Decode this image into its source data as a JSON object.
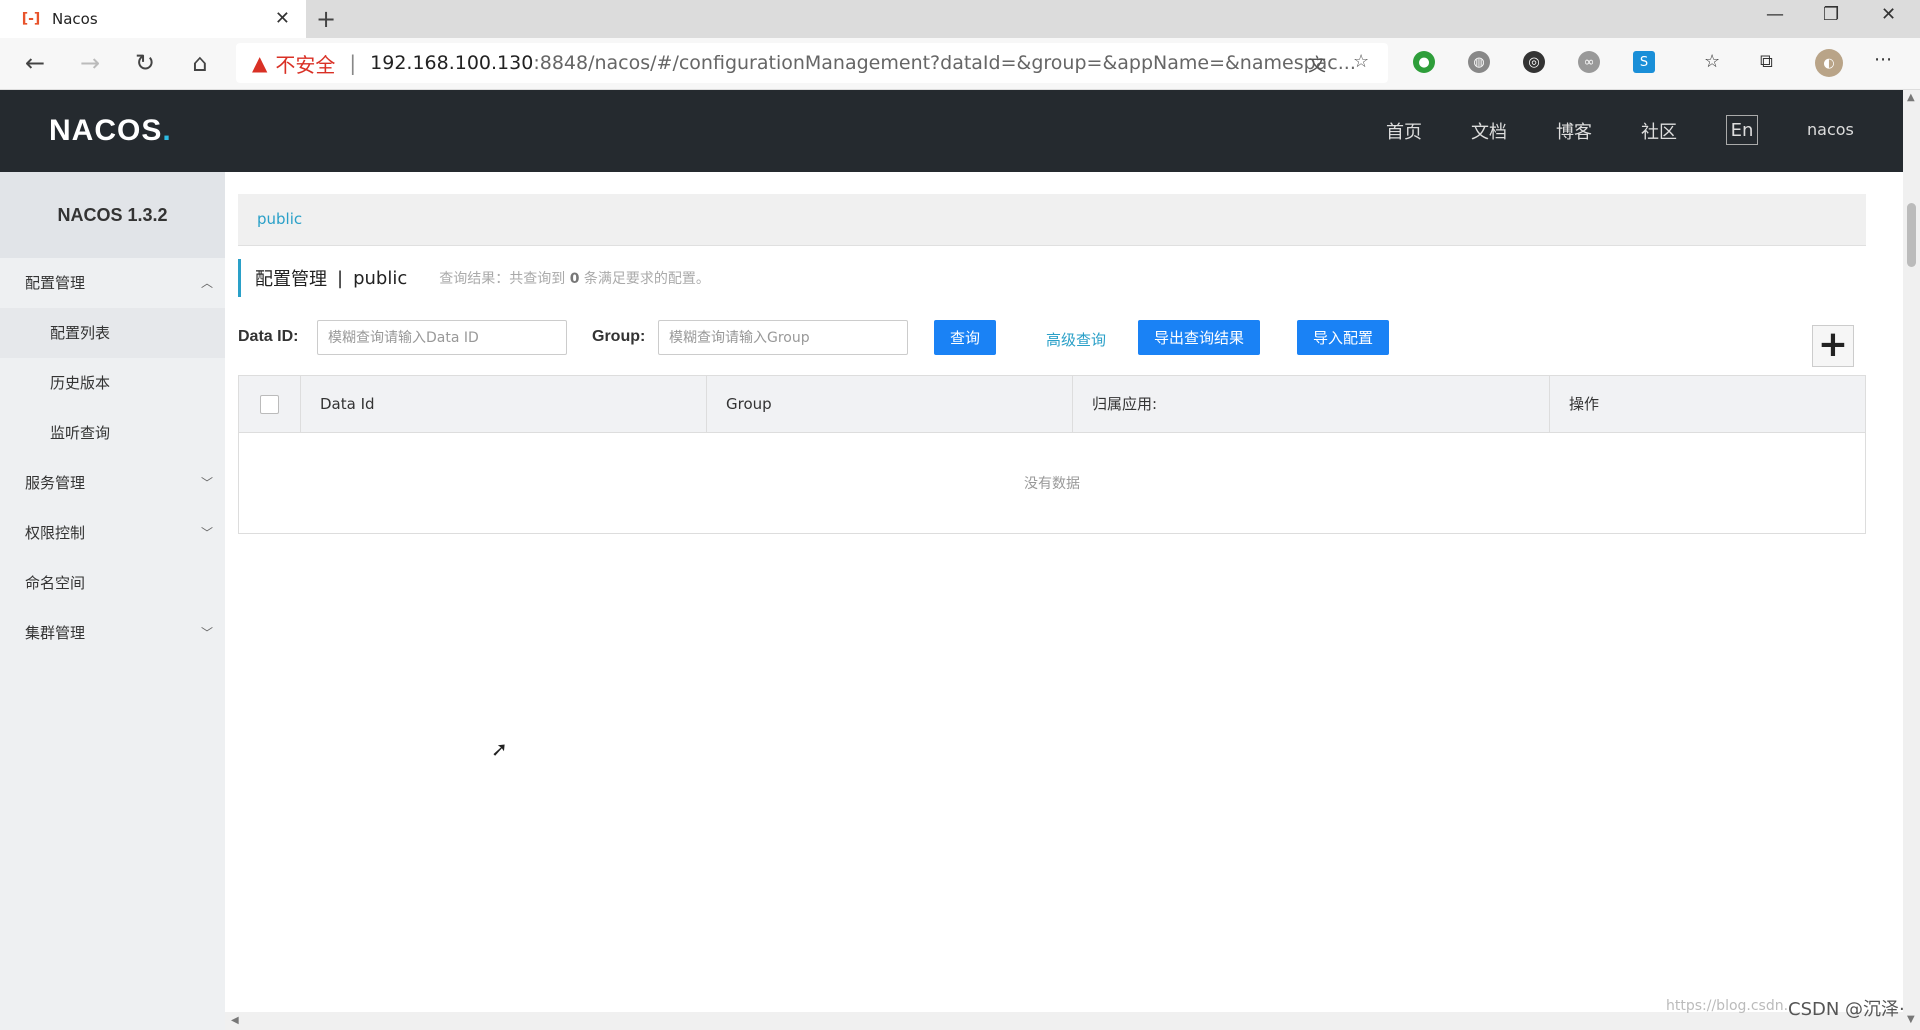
{
  "browser": {
    "tab_title": "Nacos",
    "insecure_label": "不安全",
    "url_host": "192.168.100.130",
    "url_rest": ":8848/nacos/#/configurationManagement?dataId=&group=&appName=&namespac..."
  },
  "header": {
    "logo_main": "NACOS",
    "logo_dot": ".",
    "nav": [
      "首页",
      "文档",
      "博客",
      "社区"
    ],
    "lang": "En",
    "user": "nacos"
  },
  "sidebar": {
    "version": "NACOS 1.3.2",
    "config_mgmt": "配置管理",
    "config_list": "配置列表",
    "history": "历史版本",
    "listen_query": "监听查询",
    "service_mgmt": "服务管理",
    "auth_ctrl": "权限控制",
    "namespace": "命名空间",
    "cluster_mgmt": "集群管理"
  },
  "main": {
    "namespace_tab": "public",
    "title": "配置管理",
    "title_sep": "|",
    "title_ns": "public",
    "result_prefix": "查询结果：共查询到 ",
    "result_count": "0",
    "result_suffix": " 条满足要求的配置。",
    "filters": {
      "dataid_label": "Data ID:",
      "dataid_placeholder": "模糊查询请输入Data ID",
      "group_label": "Group:",
      "group_placeholder": "模糊查询请输入Group",
      "query_btn": "查询",
      "advanced_link": "高级查询",
      "export_btn": "导出查询结果",
      "import_btn": "导入配置",
      "add_btn": "+"
    },
    "table": {
      "columns": [
        "Data Id",
        "Group",
        "归属应用:",
        "操作"
      ],
      "empty": "没有数据"
    }
  },
  "watermark": {
    "url": "https://blog.csdn.",
    "text": "CSDN @沉泽·"
  }
}
